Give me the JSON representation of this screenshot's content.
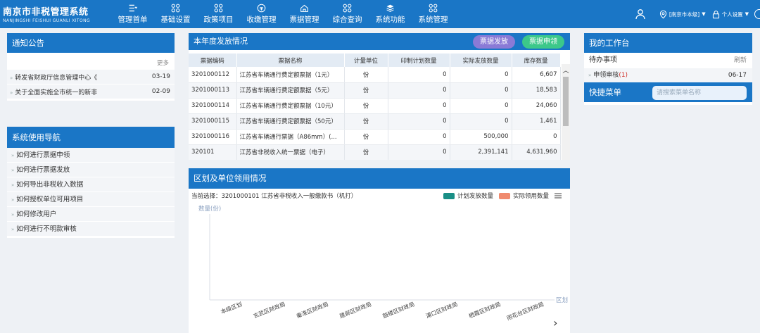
{
  "header": {
    "brand_title": "南京市非税管理系统",
    "brand_sub": "NANJINGSHI FEISHUI GUANLI XITONG",
    "nav": [
      {
        "label": "管理首单",
        "icon": "menu-icon"
      },
      {
        "label": "基础设置",
        "icon": "grid-icon"
      },
      {
        "label": "政策项目",
        "icon": "grid-icon"
      },
      {
        "label": "收缴管理",
        "icon": "coin-icon"
      },
      {
        "label": "票据管理",
        "icon": "home-icon"
      },
      {
        "label": "综合查询",
        "icon": "grid-icon"
      },
      {
        "label": "系统功能",
        "icon": "layers-icon"
      },
      {
        "label": "系统管理",
        "icon": "grid-icon"
      }
    ],
    "region": "[南京市本级]",
    "settings": "个人设置"
  },
  "notice": {
    "title": "通知公告",
    "more": "更多",
    "items": [
      {
        "text": "转发省财政厅信息管理中心《",
        "date": "03-19"
      },
      {
        "text": "关于全面实施全市统一的新非",
        "date": "02-09"
      }
    ]
  },
  "guide": {
    "title": "系统使用导航",
    "items": [
      "如何进行票据申领",
      "如何进行票据发放",
      "如何导出非税收入数据",
      "如何授权单位可用项目",
      "如何修改用户",
      "如何进行不明款审核"
    ]
  },
  "tickets": {
    "title": "本年度发放情况",
    "issue_btn": "票据发放",
    "apply_btn": "票据申领",
    "columns": [
      "票据编码",
      "票据名称",
      "计量单位",
      "印制计划数量",
      "实际发放数量",
      "库存数量"
    ],
    "rows": [
      [
        "3201000112",
        "江苏省车辆通行费定额票据（1元）",
        "份",
        "0",
        "0",
        "6,607"
      ],
      [
        "3201000113",
        "江苏省车辆通行费定额票据（5元）",
        "份",
        "0",
        "0",
        "18,583"
      ],
      [
        "3201000114",
        "江苏省车辆通行费定额票据（10元）",
        "份",
        "0",
        "0",
        "24,060"
      ],
      [
        "3201000115",
        "江苏省车辆通行费定额票据（50元）",
        "份",
        "0",
        "0",
        "1,461"
      ],
      [
        "3201000116",
        "江苏省车辆通行票据（A86mm）(...",
        "份",
        "0",
        "500,000",
        "0"
      ],
      [
        "320101",
        "江苏省非税收入统一票据（电子）",
        "份",
        "0",
        "2,391,141",
        "4,631,960"
      ]
    ]
  },
  "chart_panel": {
    "title": "区划及单位领用情况",
    "current": "当前选择：3201000101 江苏省非税收入一般缴款书（机打）",
    "legend_plan": "计划发放数量",
    "legend_actual": "实际领用数量",
    "color_plan": "#1a8f86",
    "color_actual": "#f08a6e"
  },
  "chart_data": {
    "type": "bar",
    "ylabel": "数量(份)",
    "xlabel": "区划",
    "categories": [
      "本级区划",
      "玄武区财政局",
      "秦淮区财政局",
      "建邺区财政局",
      "鼓楼区财政局",
      "浦口区财政局",
      "栖霞区财政局",
      "雨花台区财政局"
    ],
    "series": [
      {
        "name": "计划发放数量",
        "values": [
          0,
          0,
          0,
          0,
          0,
          0,
          0,
          0
        ]
      },
      {
        "name": "实际领用数量",
        "values": [
          0,
          0,
          0,
          0,
          0,
          0,
          0,
          0
        ]
      }
    ]
  },
  "workbench": {
    "title": "我的工作台",
    "todo_title": "待办事项",
    "refresh": "刷新",
    "todo_items": [
      {
        "label": "申领审核",
        "count": "(1)",
        "date": "06-17"
      }
    ]
  },
  "quick": {
    "title": "快捷菜单",
    "placeholder": "请搜索菜单名称"
  }
}
